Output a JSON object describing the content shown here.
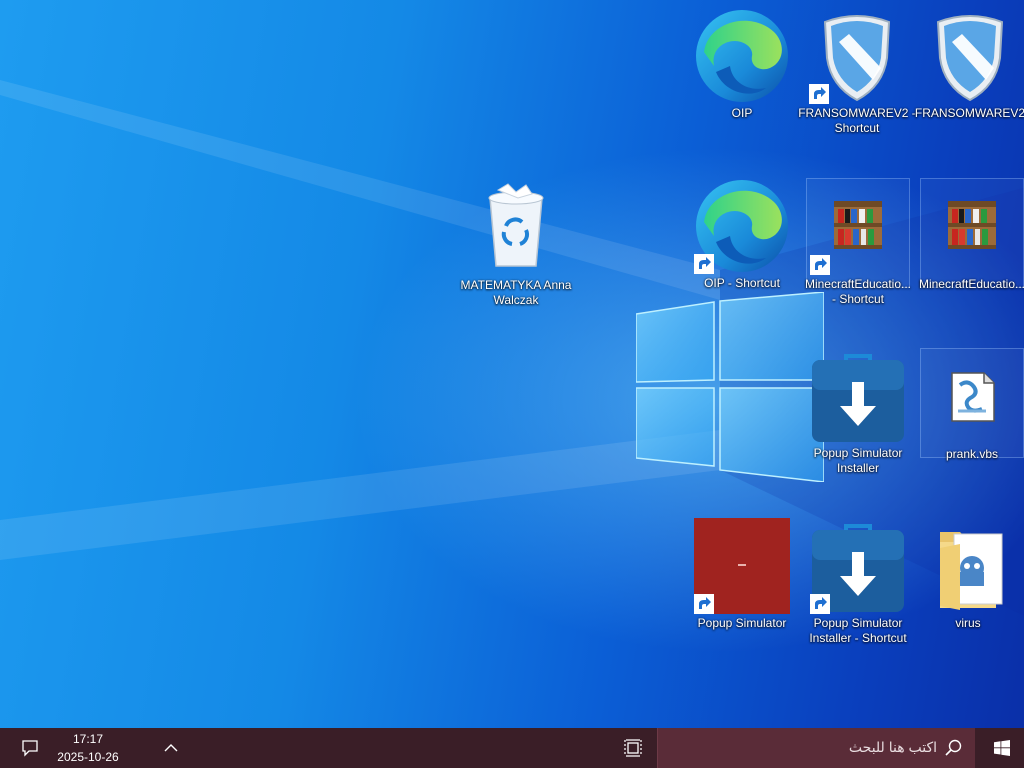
{
  "desktop": {
    "recycle_bin": {
      "label": "MATEMATYKA Anna\nWalczak",
      "icon": "recycle-bin-icon"
    },
    "icons": [
      {
        "id": "oip",
        "label": "OIP",
        "icon": "edge-icon",
        "shortcut": false
      },
      {
        "id": "fransomware-shortcut",
        "label": "FRANSOMWAREV2 -\nShortcut",
        "icon": "shield-icon",
        "shortcut": true
      },
      {
        "id": "fransomware",
        "label": "FRANSOMWAREV2",
        "icon": "shield-icon",
        "shortcut": false
      },
      {
        "id": "oip-shortcut",
        "label": "OIP - Shortcut",
        "icon": "edge-icon",
        "shortcut": true
      },
      {
        "id": "minecraft-shortcut",
        "label": "MinecraftEducatio...\n- Shortcut",
        "icon": "bookshelf-icon",
        "shortcut": true
      },
      {
        "id": "minecraft",
        "label": "MinecraftEducatio...",
        "icon": "bookshelf-icon",
        "shortcut": false
      },
      {
        "id": "popup-installer",
        "label": "Popup Simulator\nInstaller",
        "icon": "installer-icon",
        "shortcut": false
      },
      {
        "id": "prank",
        "label": "prank.vbs",
        "icon": "script-file-icon",
        "shortcut": false
      },
      {
        "id": "popup-simulator",
        "label": "Popup Simulator",
        "icon": "red-app-icon",
        "shortcut": true
      },
      {
        "id": "popup-installer-shortcut",
        "label": "Popup Simulator\nInstaller - Shortcut",
        "icon": "installer-icon",
        "shortcut": true
      },
      {
        "id": "virus",
        "label": "virus",
        "icon": "folder-icon",
        "shortcut": false
      }
    ]
  },
  "taskbar": {
    "time": "17:17",
    "date": "2025-10-26",
    "search_placeholder": "اكتب هنا للبحث",
    "colors": {
      "taskbar": "#3a1e27",
      "search": "#5a2c38"
    }
  }
}
